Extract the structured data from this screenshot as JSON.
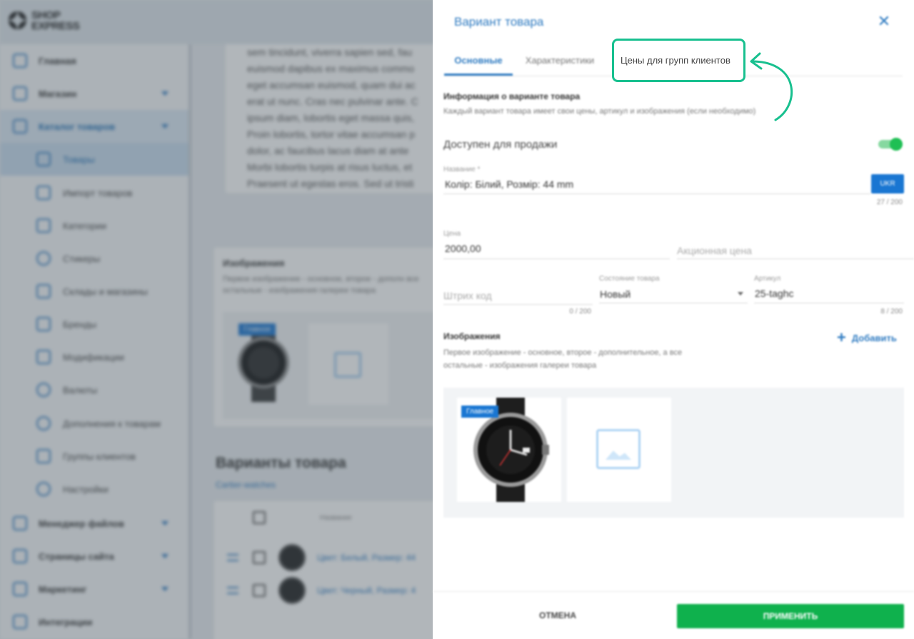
{
  "brand": {
    "logo_line1": "SHOP",
    "logo_line2": "EXPRESS"
  },
  "sidebar": {
    "items": [
      {
        "label": "Главная"
      },
      {
        "label": "Магазин"
      },
      {
        "label": "Каталог товаров"
      },
      {
        "label": "Товары"
      },
      {
        "label": "Импорт товаров"
      },
      {
        "label": "Категории"
      },
      {
        "label": "Стикеры"
      },
      {
        "label": "Склады и магазины"
      },
      {
        "label": "Бренды"
      },
      {
        "label": "Модификации"
      },
      {
        "label": "Валюты"
      },
      {
        "label": "Дополнения к товарам"
      },
      {
        "label": "Группы клиентов"
      },
      {
        "label": "Настройки"
      },
      {
        "label": "Менеджер файлов"
      },
      {
        "label": "Страницы сайта"
      },
      {
        "label": "Маркетинг"
      },
      {
        "label": "Интеграции"
      }
    ]
  },
  "background": {
    "lorem_lines": [
      "sem tincidunt, viverra sapien sed, fau",
      "euismod dapibus ex maximus commo",
      "eget accumsan euismod, quam dui ac",
      "erat ut nunc. Cras nec pulvinar ante. C",
      "ipsum diam, lobortis eget massa quis,",
      "Proin lobortis, tortor vitae accumsan p",
      "dolor, ac faucibus lacus diam at ante",
      "Morbi lobortis turpis at risus luctus, et",
      "Praesent ut egestas eros. Sed ut tristi"
    ],
    "images_title": "Изображения",
    "images_desc": "Первое изображение - основное, второе - дополн все остальные - изображения галереи товара",
    "main_badge": "Главное",
    "variants_title": "Варианты товара",
    "variants_link": "Cartier-watches",
    "table_header": "Название",
    "rows": [
      {
        "name": "Цвет: Белый, Размер: 44"
      },
      {
        "name": "Цвет: Черный, Размер: 4"
      }
    ]
  },
  "dialog": {
    "title": "Вариант товара",
    "tabs": [
      {
        "label": "Основные"
      },
      {
        "label": "Характеристики"
      },
      {
        "label": "Цены для групп клиентов"
      }
    ],
    "info_title": "Информация о варианте товара",
    "info_desc": "Каждый вариант товара имеет свои цены, артикул и изображения (если необходимо)",
    "available_label": "Доступен для продажи",
    "available": true,
    "name_label": "Название *",
    "name_value": "Колір: Білий, Розмір: 44 mm",
    "name_counter": "27 / 200",
    "ukr_button": "UKR",
    "price_label": "Цена",
    "price_value": "2000,00",
    "sale_price_placeholder": "Акционная цена",
    "barcode_placeholder": "Штрих код",
    "barcode_counter": "0 / 200",
    "condition_label": "Состояние товара",
    "condition_value": "Новый",
    "sku_label": "Артикул",
    "sku_value": "25-taghc",
    "sku_counter": "8 / 200",
    "images_title": "Изображения",
    "images_desc_1": "Первое изображение - основное, второе - дополнительное, а все",
    "images_desc_2": "остальные - изображения галереи товара",
    "add_label": "Добавить",
    "main_badge": "Главное",
    "cancel": "ОТМЕНА",
    "apply": "ПРИМЕНИТЬ"
  },
  "colors": {
    "accent": "#2f7bc1",
    "apply": "#0fb14d",
    "highlight": "#18c08f"
  }
}
